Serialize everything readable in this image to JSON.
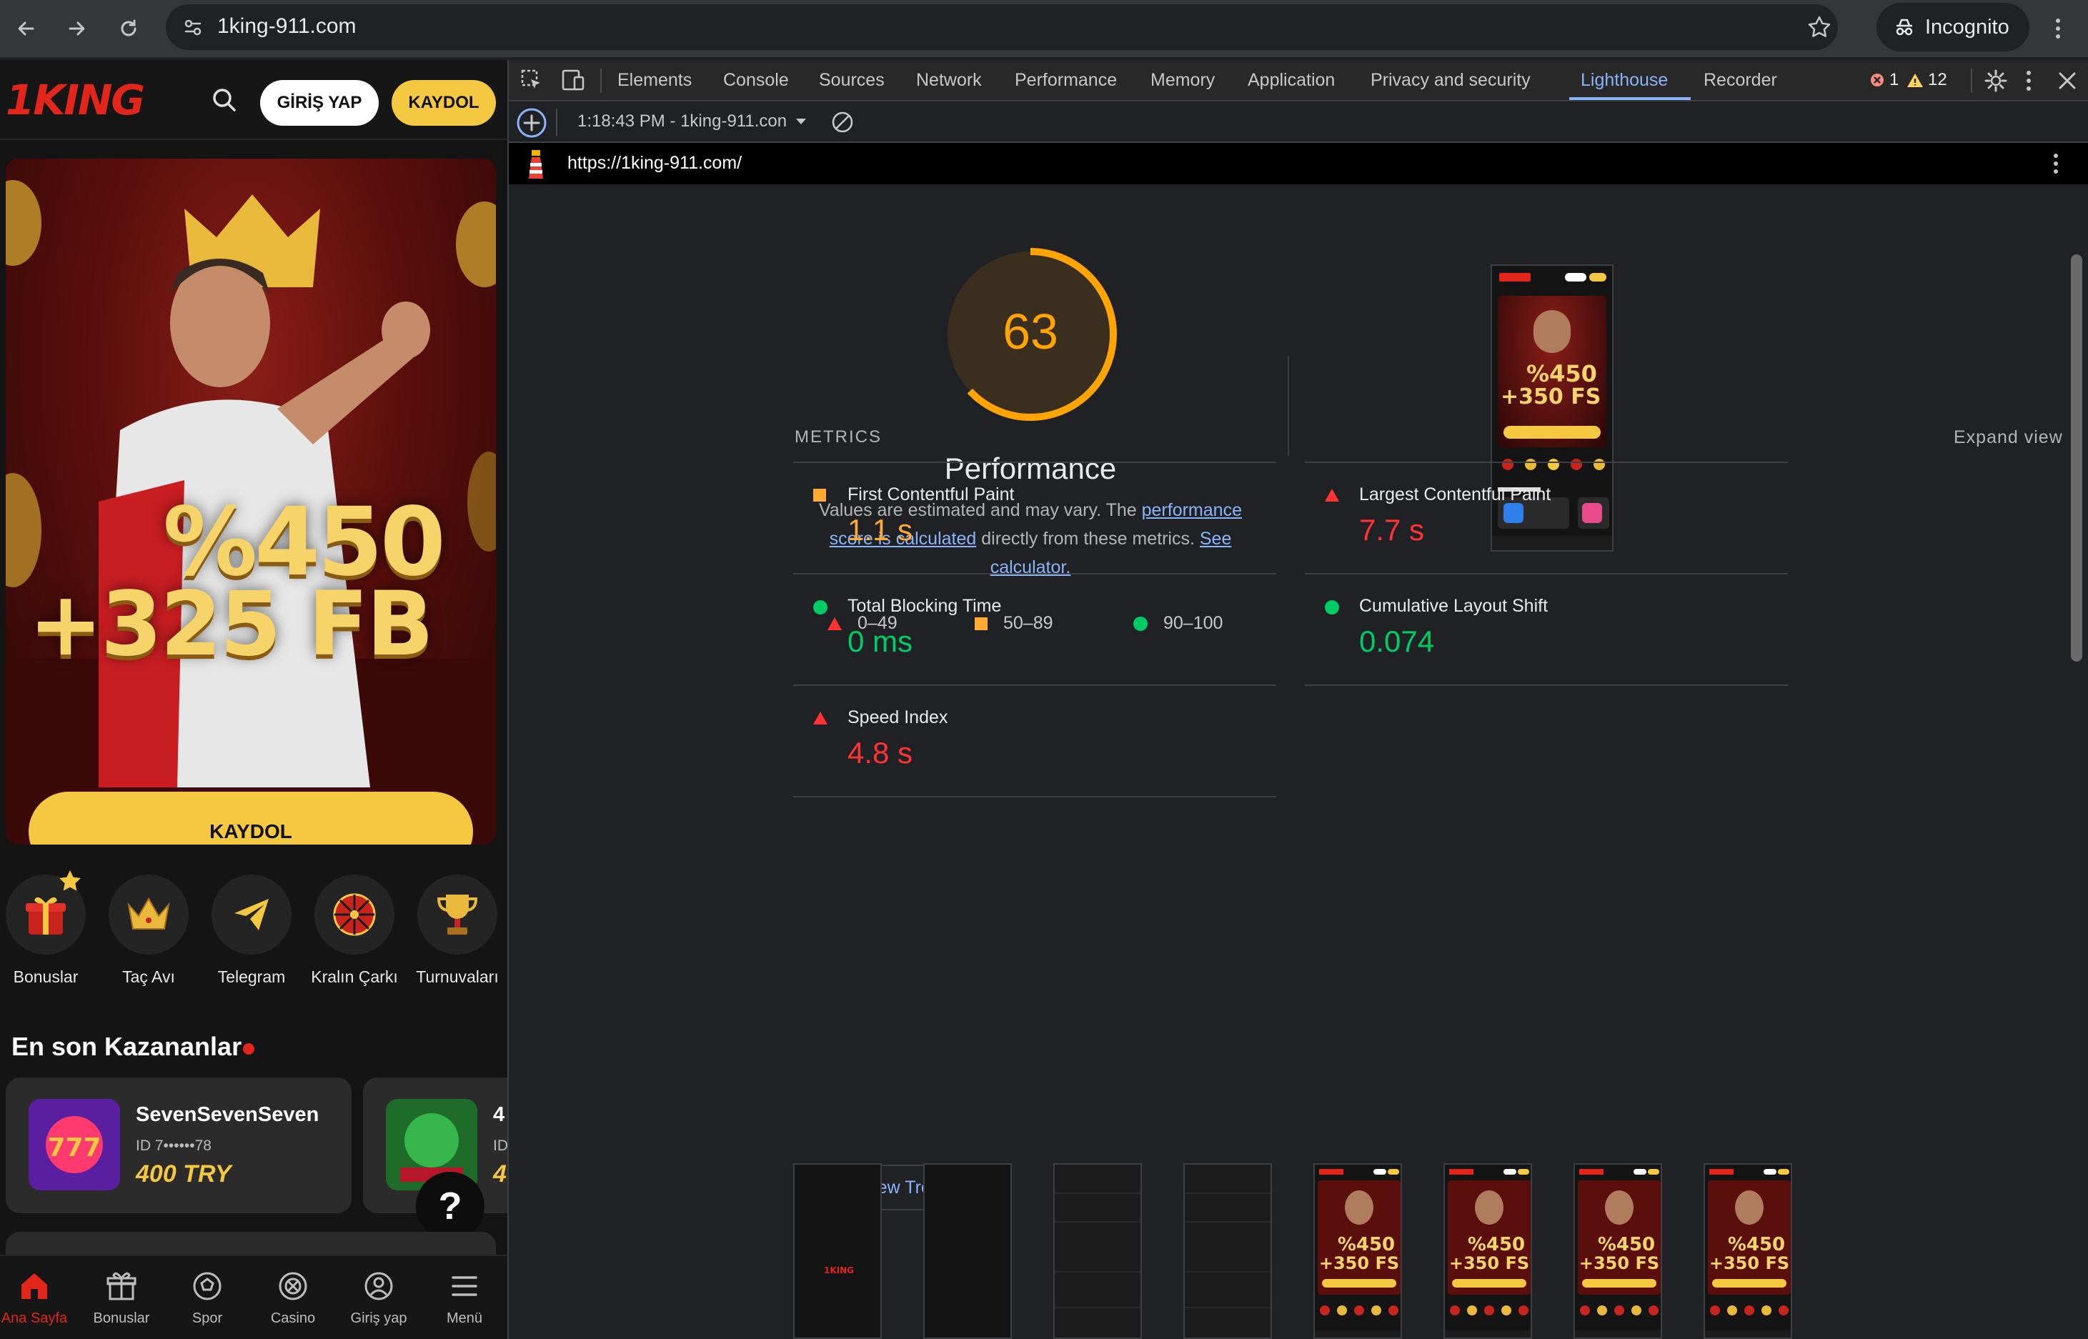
{
  "browser": {
    "url": "1king-911.com",
    "incognito_label": "Incognito"
  },
  "site": {
    "logo": "1KING",
    "login_label": "GİRİŞ YAP",
    "register_label": "KAYDOL",
    "banner": {
      "promo_line1": "%450",
      "promo_line2": "+325 FB",
      "cta_label": "KAYDOL"
    },
    "quick_links": [
      {
        "label": "Bonuslar",
        "icon": "gift-icon"
      },
      {
        "label": "Taç Avı",
        "icon": "crown-icon"
      },
      {
        "label": "Telegram",
        "icon": "telegram-icon"
      },
      {
        "label": "Kralın Çarkı",
        "icon": "wheel-icon"
      },
      {
        "label": "Turnuvaları",
        "icon": "trophy-icon"
      }
    ],
    "winners_title": "En son Kazananlar",
    "winners": [
      {
        "name": "SevenSevenSeven",
        "id": "ID 7••••••78",
        "amount": "400 TRY"
      },
      {
        "name": "4",
        "id": "ID",
        "amount": "4"
      }
    ],
    "help_label": "?",
    "tabbar": [
      {
        "label": "Ana Sayfa",
        "icon": "home-icon",
        "active": true
      },
      {
        "label": "Bonuslar",
        "icon": "gift-icon",
        "active": false
      },
      {
        "label": "Spor",
        "icon": "ball-icon",
        "active": false
      },
      {
        "label": "Casino",
        "icon": "casino-chip-icon",
        "active": false
      },
      {
        "label": "Giriş yap",
        "icon": "user-icon",
        "active": false
      },
      {
        "label": "Menü",
        "icon": "menu-icon",
        "active": false
      }
    ]
  },
  "devtools": {
    "tabs": [
      "Elements",
      "Console",
      "Sources",
      "Network",
      "Performance",
      "Memory",
      "Application",
      "Privacy and security",
      "Lighthouse",
      "Recorder"
    ],
    "active_tab": "Lighthouse",
    "error_count": "1",
    "warning_count": "12",
    "report_selector": "1:18:43 PM - 1king-911.con",
    "report_url": "https://1king-911.com/",
    "lighthouse": {
      "score": "63",
      "score_fraction": 0.63,
      "category": "Performance",
      "desc_part1": "Values are estimated and may vary. The ",
      "desc_link1": "performance score is calculated",
      "desc_part2": " directly from these metrics. ",
      "desc_link2": "See calculator.",
      "legend": [
        {
          "range": "0–49",
          "shape": "triangle",
          "color": "#f33"
        },
        {
          "range": "50–89",
          "shape": "square",
          "color": "#fa3"
        },
        {
          "range": "90–100",
          "shape": "circle",
          "color": "#0c6"
        }
      ],
      "metrics_heading": "METRICS",
      "expand_label": "Expand view",
      "metrics": [
        {
          "label": "First Contentful Paint",
          "value": "1.1 s",
          "status": "average"
        },
        {
          "label": "Largest Contentful Paint",
          "value": "7.7 s",
          "status": "fail"
        },
        {
          "label": "Total Blocking Time",
          "value": "0 ms",
          "status": "pass"
        },
        {
          "label": "Cumulative Layout Shift",
          "value": "0.074",
          "status": "pass"
        },
        {
          "label": "Speed Index",
          "value": "4.8 s",
          "status": "fail"
        }
      ],
      "treemap_label": "View Treemap",
      "screenshot_thumb_promo1": "%450",
      "screenshot_thumb_promo2": "+350 FS",
      "filmstrip_promo1": "%450",
      "filmstrip_promo2": "+350 FS",
      "filmstrip_logo": "1KING"
    }
  }
}
